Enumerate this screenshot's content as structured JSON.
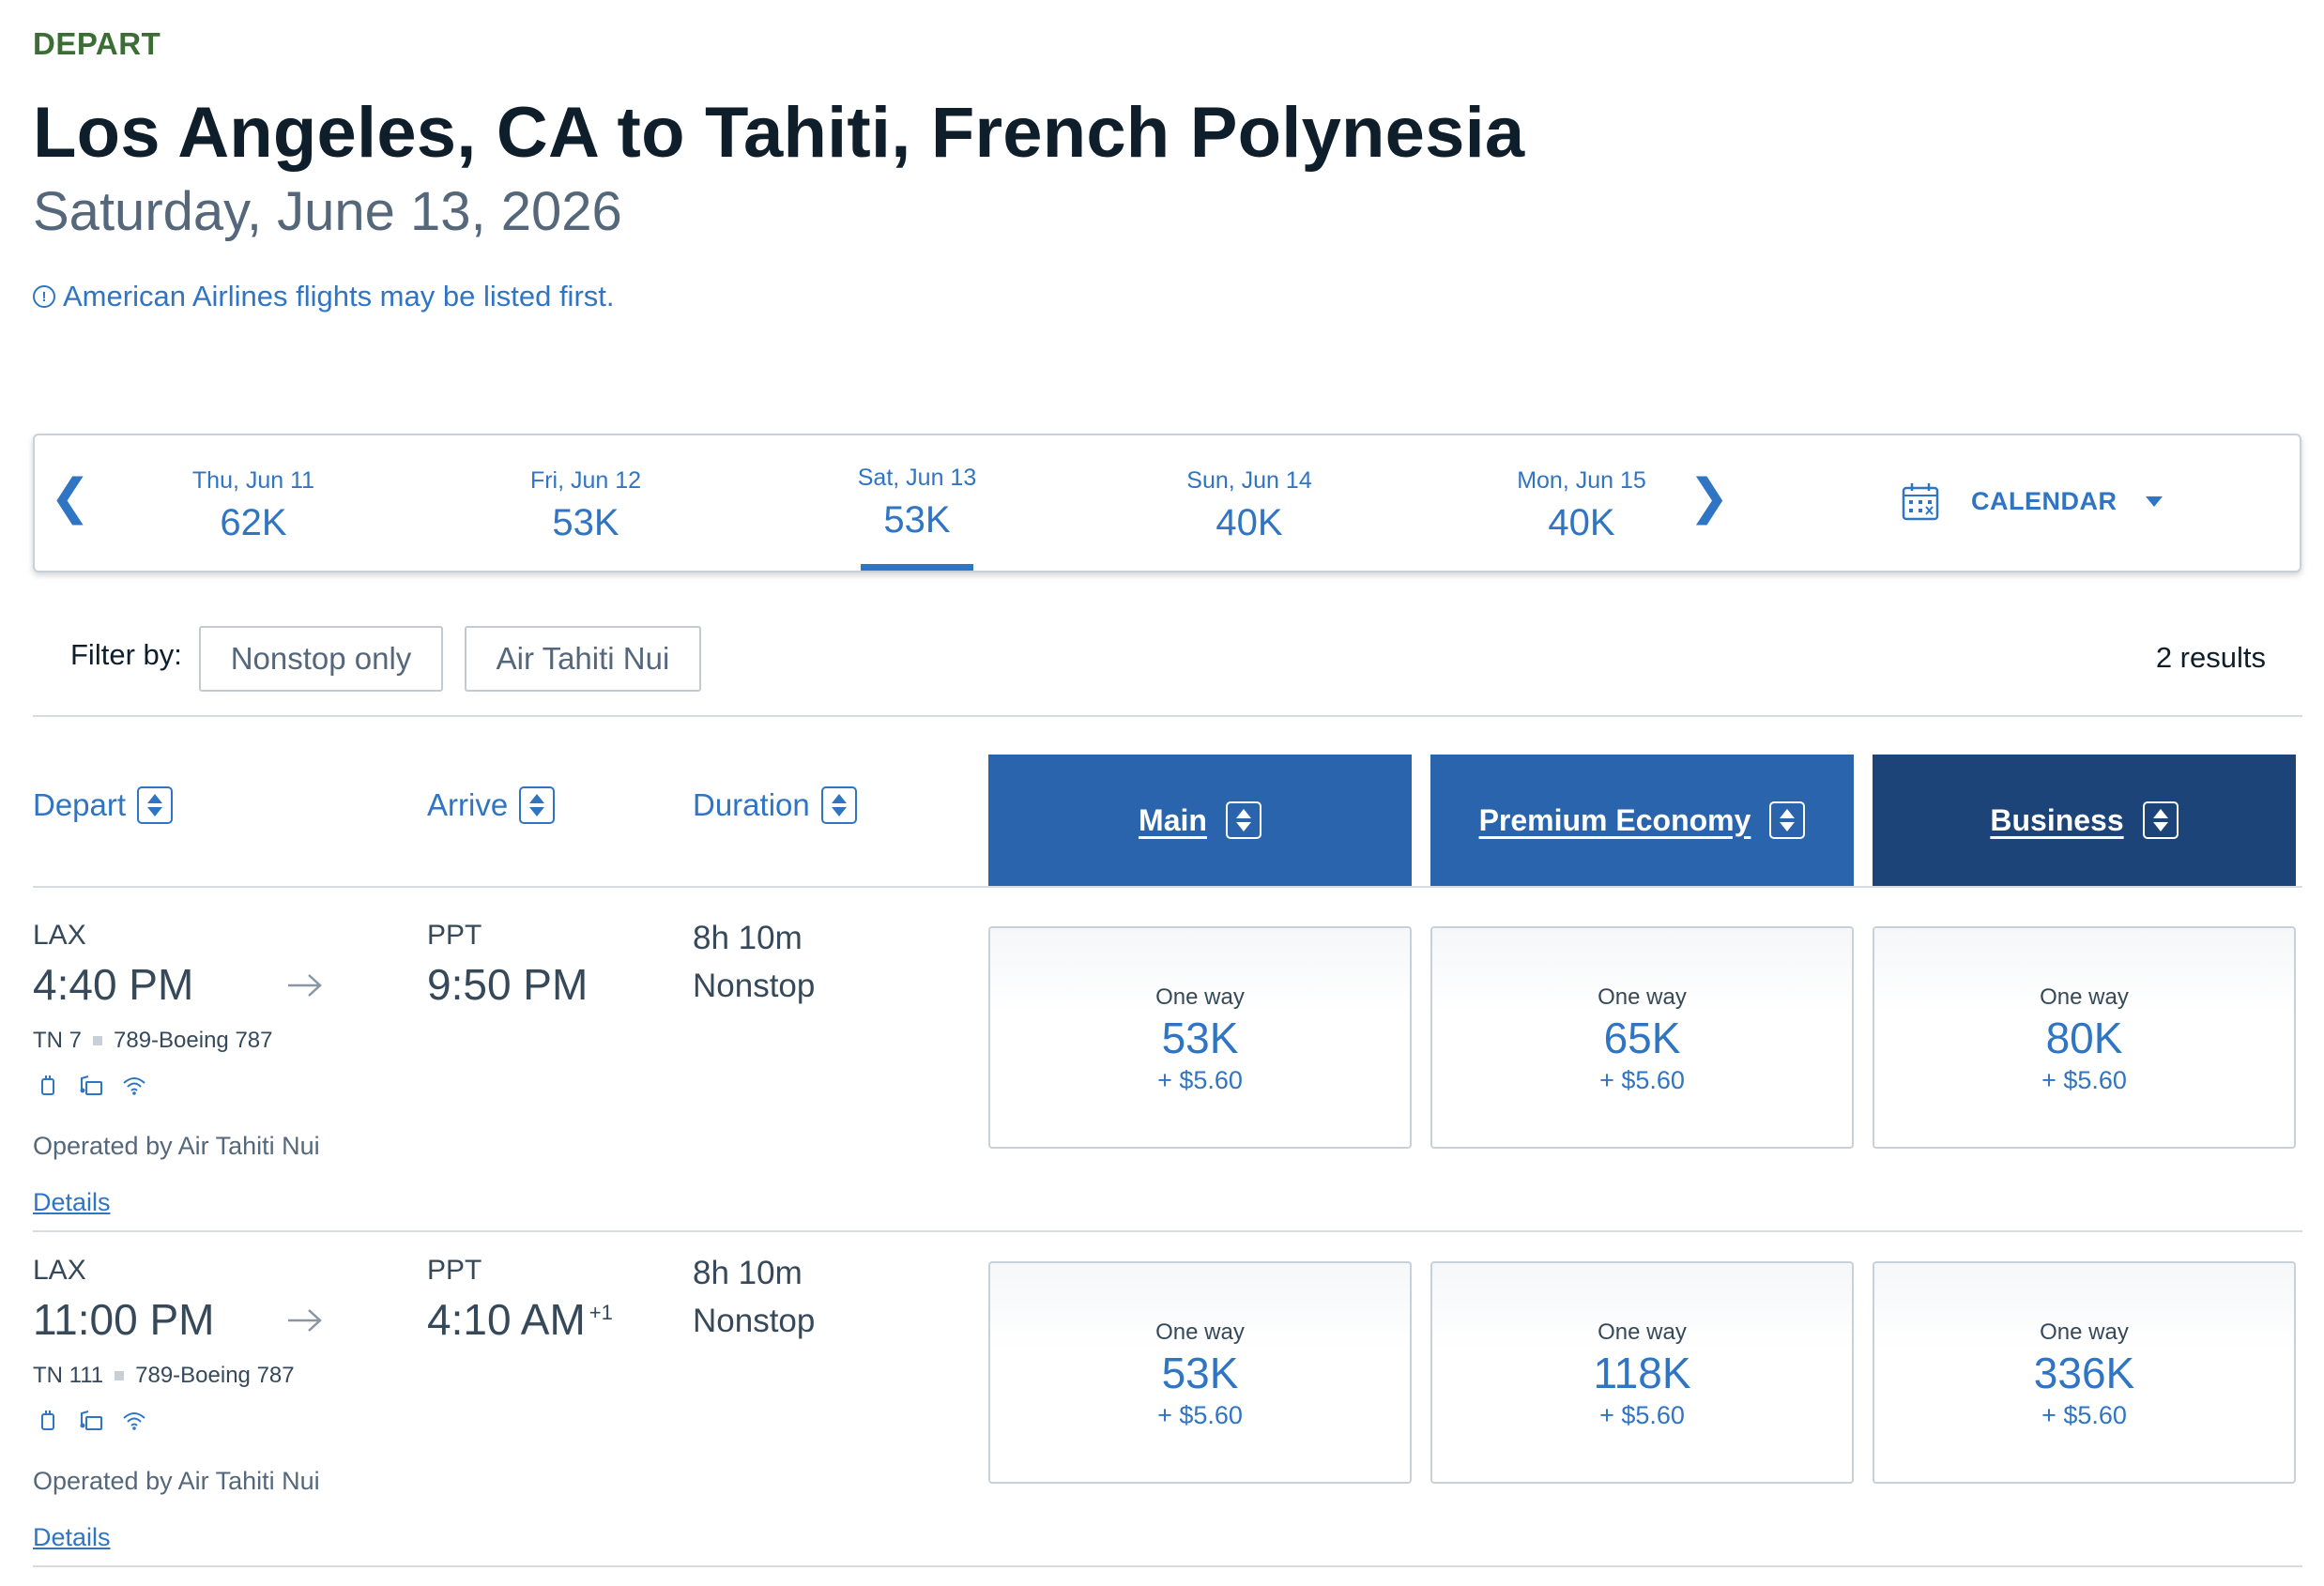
{
  "header": {
    "eyebrow": "DEPART",
    "title": "Los Angeles, CA to Tahiti, French Polynesia",
    "subtitle": "Saturday, June 13, 2026",
    "notice": "American Airlines flights may be listed first."
  },
  "date_strip": {
    "prev_glyph": "❮",
    "next_glyph": "❯",
    "dates": [
      {
        "label": "Thu, Jun 11",
        "price": "62K",
        "selected": false
      },
      {
        "label": "Fri, Jun 12",
        "price": "53K",
        "selected": false
      },
      {
        "label": "Sat, Jun 13",
        "price": "53K",
        "selected": true
      },
      {
        "label": "Sun, Jun 14",
        "price": "40K",
        "selected": false
      },
      {
        "label": "Mon, Jun 15",
        "price": "40K",
        "selected": false
      }
    ],
    "calendar_label": "CALENDAR"
  },
  "filters": {
    "label": "Filter by:",
    "chips": [
      "Nonstop only",
      "Air Tahiti Nui"
    ],
    "results": "2 results"
  },
  "columns": {
    "depart": "Depart",
    "arrive": "Arrive",
    "duration": "Duration",
    "cabins": [
      {
        "label": "Main",
        "color": "#2a64ad"
      },
      {
        "label": "Premium Economy",
        "color": "#2a64ad"
      },
      {
        "label": "Business",
        "color": "#1d4479"
      }
    ]
  },
  "flights": [
    {
      "origin": "LAX",
      "depart_time": "4:40 PM",
      "destination": "PPT",
      "arrive_time": "9:50 PM",
      "arrive_offset": "",
      "flight_number": "TN 7",
      "aircraft": "789-Boeing 787",
      "duration": "8h 10m",
      "stops": "Nonstop",
      "operated_by": "Operated by Air Tahiti Nui",
      "details": "Details",
      "fares": [
        {
          "label": "One way",
          "points": "53K",
          "tax": "+ $5.60"
        },
        {
          "label": "One way",
          "points": "65K",
          "tax": "+ $5.60"
        },
        {
          "label": "One way",
          "points": "80K",
          "tax": "+ $5.60"
        }
      ]
    },
    {
      "origin": "LAX",
      "depart_time": "11:00 PM",
      "destination": "PPT",
      "arrive_time": "4:10 AM",
      "arrive_offset": "+1",
      "flight_number": "TN 111",
      "aircraft": "789-Boeing 787",
      "duration": "8h 10m",
      "stops": "Nonstop",
      "operated_by": "Operated by Air Tahiti Nui",
      "details": "Details",
      "fares": [
        {
          "label": "One way",
          "points": "53K",
          "tax": "+ $5.60"
        },
        {
          "label": "One way",
          "points": "118K",
          "tax": "+ $5.60"
        },
        {
          "label": "One way",
          "points": "336K",
          "tax": "+ $5.60"
        }
      ]
    }
  ],
  "amenity_icons": [
    "power-outlet-icon",
    "entertainment-icon",
    "wifi-icon"
  ],
  "colors": {
    "accent": "#2f75c4",
    "eyebrow": "#3b6e35",
    "business_header": "#1d4479",
    "cabin_header": "#2a64ad"
  }
}
